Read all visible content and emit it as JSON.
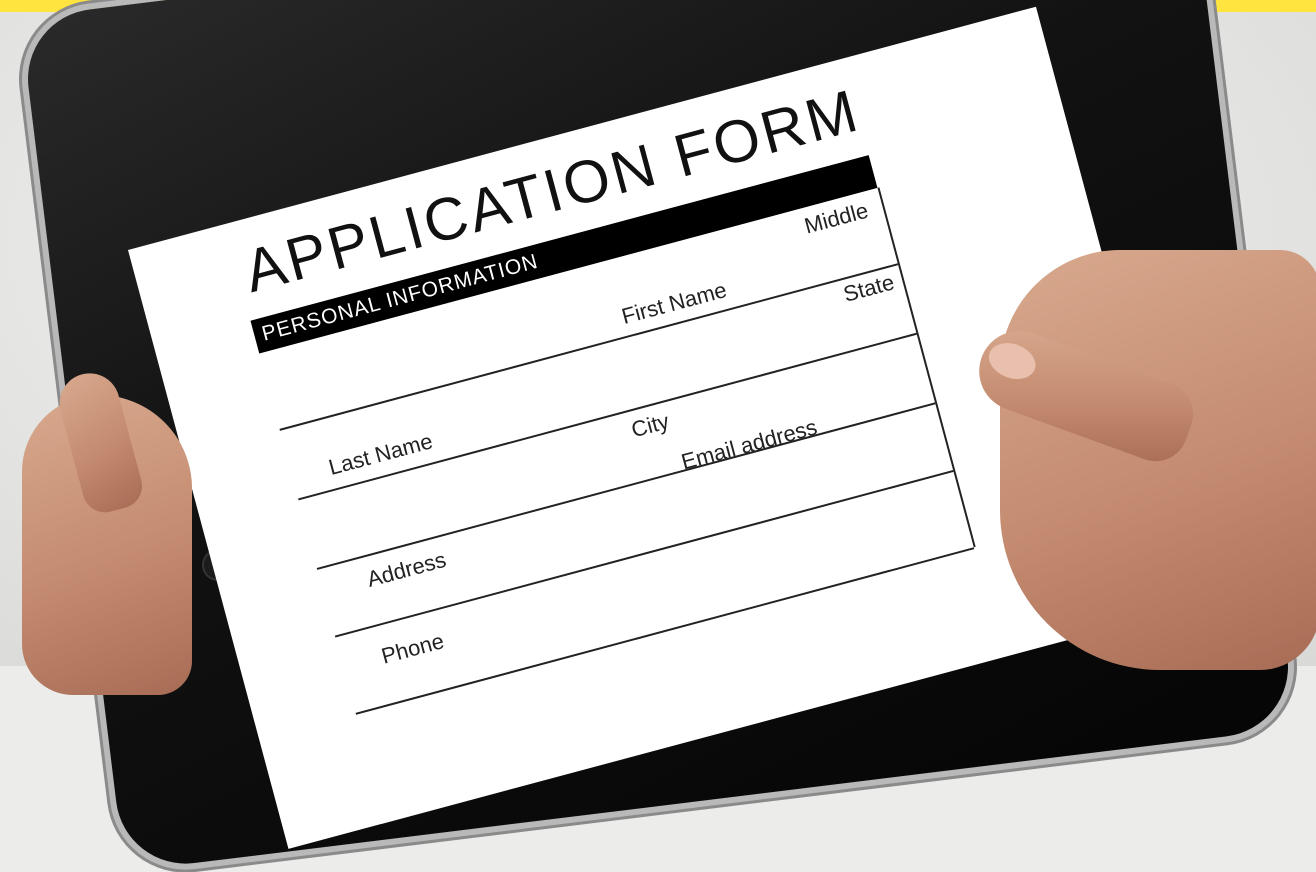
{
  "form": {
    "title": "APPLICATION FORM",
    "section": "PERSONAL INFORMATION",
    "labels": {
      "middle": "Middle",
      "first_name": "First Name",
      "last_name": "Last Name",
      "state": "State",
      "city": "City",
      "address": "Address",
      "email": "Email address",
      "phone": "Phone"
    }
  },
  "colors": {
    "accent_bar": "#ffe33f",
    "tablet": "#111111",
    "screen": "#ffffff",
    "skin": "#c48b70"
  }
}
